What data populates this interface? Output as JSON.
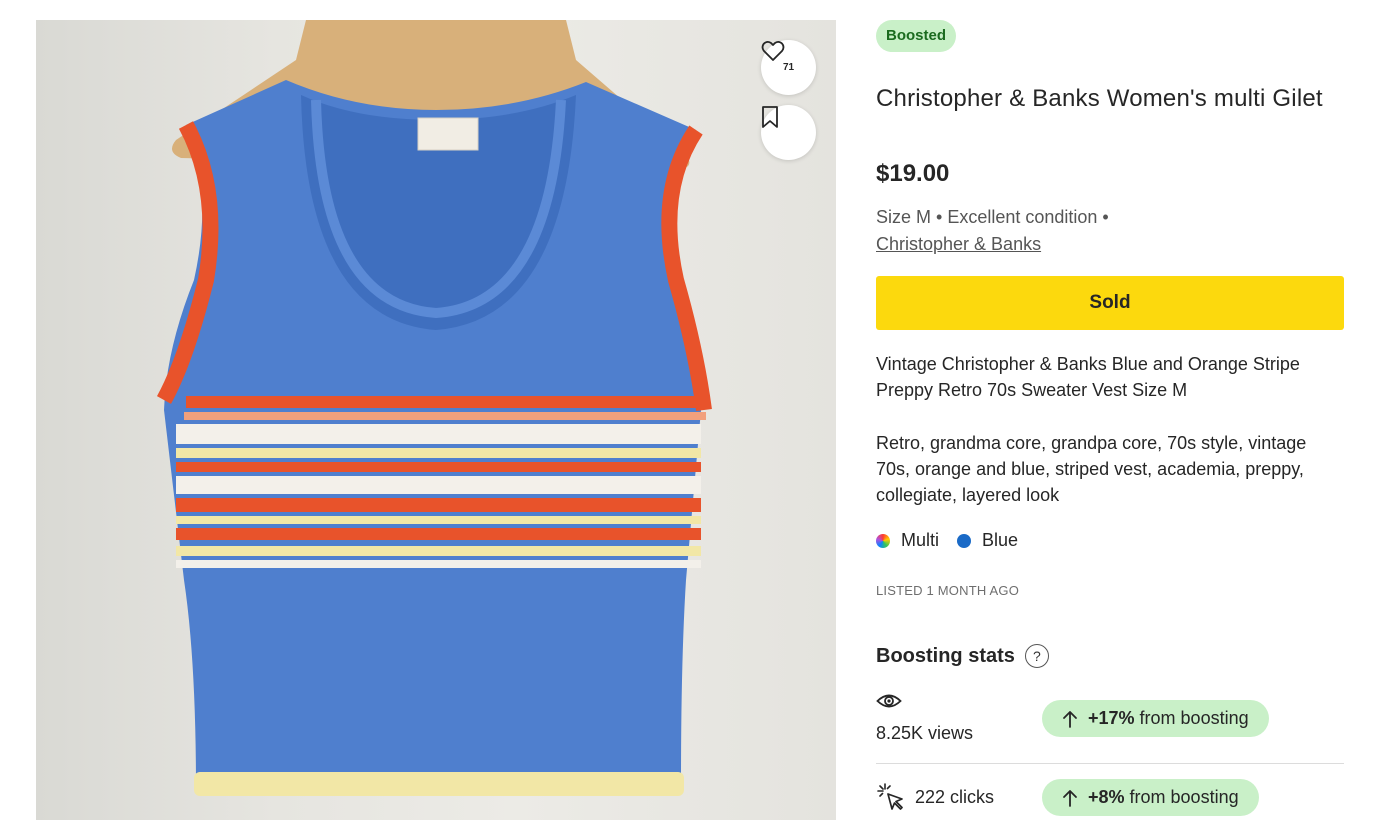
{
  "listing": {
    "badge": "Boosted",
    "title": "Christopher & Banks Women's multi Gilet",
    "price": "$19.00",
    "meta_prefix": "Size M • Excellent condition •",
    "brand_link": "Christopher & Banks",
    "status_button": "Sold",
    "description": [
      "Vintage Christopher & Banks Blue and Orange Stripe Preppy Retro 70s Sweater Vest Size M",
      "Retro, grandma core, grandpa core, 70s style, vintage 70s, orange and blue, striped vest, academia, preppy, collegiate, layered look"
    ],
    "colors": [
      {
        "name": "Multi",
        "swatch": "multi"
      },
      {
        "name": "Blue",
        "swatch": "#1a6ac7"
      }
    ],
    "listed": "LISTED 1 MONTH AGO"
  },
  "photo": {
    "like_count": "71",
    "icons": [
      "heart-icon",
      "bookmark-icon"
    ],
    "vest_colors": {
      "body": "#4f7fce",
      "trim": "#e8532b",
      "stripe_light": "#f2e7a6",
      "stripe_white": "#f3f0ea",
      "hanger": "#c99a63"
    }
  },
  "boosting": {
    "title": "Boosting stats",
    "help_icon": "?",
    "stats": [
      {
        "icon": "eye-icon",
        "value": "8.25K views",
        "change": "+17%",
        "suffix": "from boosting"
      },
      {
        "icon": "cursor-click-icon",
        "value": "222 clicks",
        "change": "+8%",
        "suffix": "from boosting"
      }
    ],
    "accent": "#c9f0c8"
  }
}
